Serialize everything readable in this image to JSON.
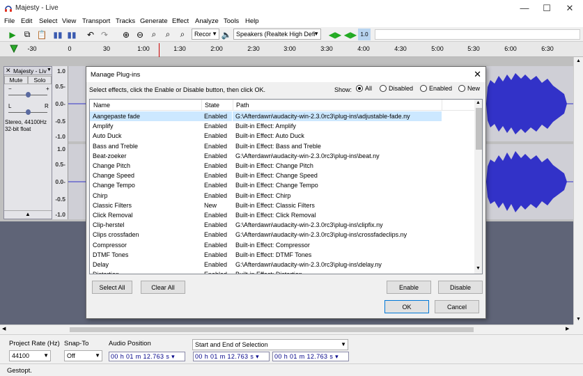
{
  "window": {
    "title": "Majesty - Live",
    "minimize": "—",
    "maximize": "☐",
    "close": "✕"
  },
  "menu": [
    "File",
    "Edit",
    "Select",
    "View",
    "Transport",
    "Tracks",
    "Generate",
    "Effect",
    "Analyze",
    "Tools",
    "Help"
  ],
  "toolbar": {
    "recording_device": "Recor",
    "playback_device": "Speakers (Realtek High Defi",
    "meter_label": "1.0"
  },
  "timeline": {
    "labels": [
      "-30",
      "0",
      "30",
      "1:00",
      "1:30",
      "2:00",
      "2:30",
      "3:00",
      "3:30",
      "4:00",
      "4:30",
      "5:00",
      "5:30",
      "6:00",
      "6:30"
    ]
  },
  "track": {
    "name": "Majesty - Liv",
    "mute": "Mute",
    "solo": "Solo",
    "gain_minus": "−",
    "gain_plus": "+",
    "pan_left": "L",
    "pan_right": "R",
    "info_line1": "Stereo, 44100Hz",
    "info_line2": "32-bit float",
    "ruler_labels": [
      "1.0",
      "0.5-",
      "0.0-",
      "-0.5",
      "-1.0",
      "1.0",
      "0.5-",
      "0.0-",
      "-0.5",
      "-1.0"
    ]
  },
  "dialog": {
    "title": "Manage Plug-ins",
    "description": "Select effects, click the Enable or Disable button, then click OK.",
    "show_label": "Show:",
    "filters": [
      {
        "label": "All",
        "selected": true
      },
      {
        "label": "Disabled",
        "selected": false
      },
      {
        "label": "Enabled",
        "selected": false
      },
      {
        "label": "New",
        "selected": false
      }
    ],
    "columns": {
      "name": "Name",
      "state": "State",
      "path": "Path"
    },
    "rows": [
      {
        "name": "Aangepaste fade",
        "state": "Enabled",
        "path": "G:\\Afterdawn\\audacity-win-2.3.0rc3\\plug-ins\\adjustable-fade.ny"
      },
      {
        "name": "Amplify",
        "state": "Enabled",
        "path": "Built-in Effect: Amplify"
      },
      {
        "name": "Auto Duck",
        "state": "Enabled",
        "path": "Built-in Effect: Auto Duck"
      },
      {
        "name": "Bass and Treble",
        "state": "Enabled",
        "path": "Built-in Effect: Bass and Treble"
      },
      {
        "name": "Beat-zoeker",
        "state": "Enabled",
        "path": "G:\\Afterdawn\\audacity-win-2.3.0rc3\\plug-ins\\beat.ny"
      },
      {
        "name": "Change Pitch",
        "state": "Enabled",
        "path": "Built-in Effect: Change Pitch"
      },
      {
        "name": "Change Speed",
        "state": "Enabled",
        "path": "Built-in Effect: Change Speed"
      },
      {
        "name": "Change Tempo",
        "state": "Enabled",
        "path": "Built-in Effect: Change Tempo"
      },
      {
        "name": "Chirp",
        "state": "Enabled",
        "path": "Built-in Effect: Chirp"
      },
      {
        "name": "Classic Filters",
        "state": "New",
        "path": "Built-in Effect: Classic Filters"
      },
      {
        "name": "Click Removal",
        "state": "Enabled",
        "path": "Built-in Effect: Click Removal"
      },
      {
        "name": "Clip-herstel",
        "state": "Enabled",
        "path": "G:\\Afterdawn\\audacity-win-2.3.0rc3\\plug-ins\\clipfix.ny"
      },
      {
        "name": "Clips crossfaden",
        "state": "Enabled",
        "path": "G:\\Afterdawn\\audacity-win-2.3.0rc3\\plug-ins\\crossfadeclips.ny"
      },
      {
        "name": "Compressor",
        "state": "Enabled",
        "path": "Built-in Effect: Compressor"
      },
      {
        "name": "DTMF Tones",
        "state": "Enabled",
        "path": "Built-in Effect: DTMF Tones"
      },
      {
        "name": "Delay",
        "state": "Enabled",
        "path": "G:\\Afterdawn\\audacity-win-2.3.0rc3\\plug-ins\\delay.ny"
      },
      {
        "name": "Distortion",
        "state": "Enabled",
        "path": "Built-in Effect: Distortion"
      }
    ],
    "buttons": {
      "select_all": "Select All",
      "clear_all": "Clear All",
      "enable": "Enable",
      "disable": "Disable",
      "ok": "OK",
      "cancel": "Cancel"
    }
  },
  "bottom": {
    "project_rate_label": "Project Rate (Hz)",
    "project_rate": "44100",
    "snap_label": "Snap-To",
    "snap_value": "Off",
    "audio_position_label": "Audio Position",
    "selection_label": "Start and End of Selection",
    "time1": "00 h 01 m 12.763 s",
    "time2": "00 h 01 m 12.763 s",
    "time3": "00 h 01 m 12.763 s"
  },
  "status": "Gestopt.",
  "colors": {
    "accent": "#0078d7",
    "waveform": "#3232c8",
    "selected_row": "#cce8ff"
  }
}
